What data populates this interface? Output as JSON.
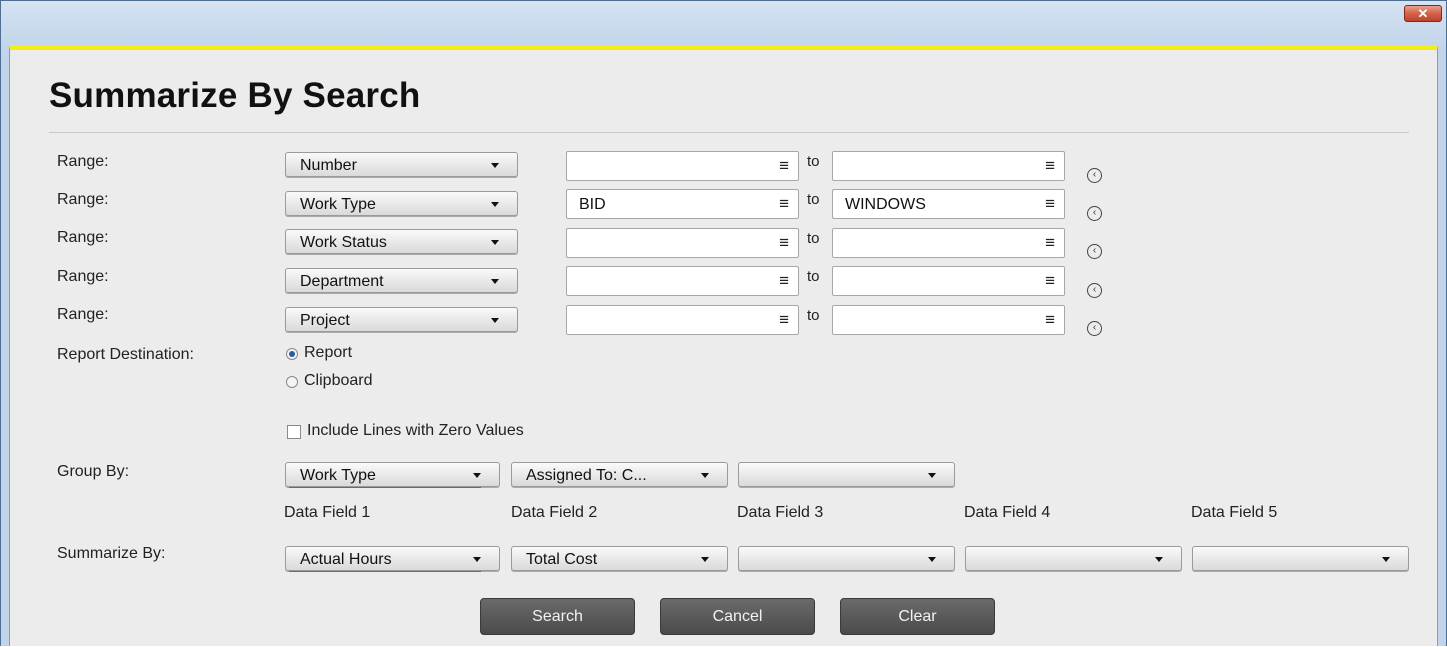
{
  "window": {
    "close_glyph": "✕"
  },
  "title": "Summarize By Search",
  "ranges": [
    {
      "label": "Range:",
      "field": "Number",
      "from": "",
      "to": ""
    },
    {
      "label": "Range:",
      "field": "Work Type",
      "from": "BID",
      "to": "WINDOWS"
    },
    {
      "label": "Range:",
      "field": "Work Status",
      "from": "",
      "to": ""
    },
    {
      "label": "Range:",
      "field": "Department",
      "from": "",
      "to": ""
    },
    {
      "label": "Range:",
      "field": "Project",
      "from": "",
      "to": ""
    }
  ],
  "to_label": "to",
  "menu_glyph": "≡",
  "clear_glyph": "‹",
  "report_destination": {
    "label": "Report Destination:",
    "options": [
      "Report",
      "Clipboard"
    ],
    "selected": "Report"
  },
  "include_zero": {
    "label": "Include Lines with Zero Values",
    "checked": false
  },
  "group_by": {
    "label": "Group By:",
    "values": [
      "Work Type",
      "Assigned To: C...",
      ""
    ]
  },
  "data_field_headers": [
    "Data Field 1",
    "Data Field 2",
    "Data Field 3",
    "Data Field 4",
    "Data Field 5"
  ],
  "summarize_by": {
    "label": "Summarize By:",
    "values": [
      "Actual Hours",
      "Total Cost",
      "",
      "",
      ""
    ]
  },
  "buttons": {
    "search": "Search",
    "cancel": "Cancel",
    "clear": "Clear"
  },
  "colors": {
    "accent_bar": "#f2ee14",
    "required_underline": "#d93a3a",
    "button_dark": "#555555"
  }
}
